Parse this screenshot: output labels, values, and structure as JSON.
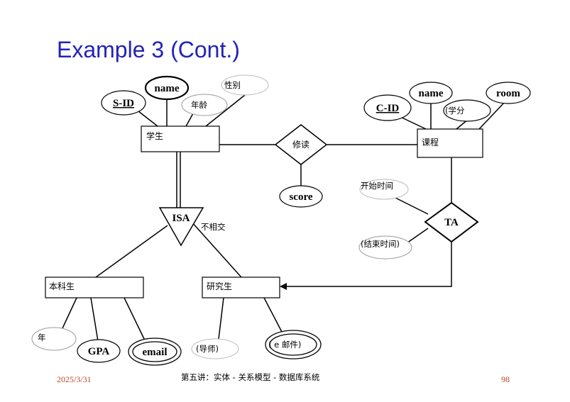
{
  "title": "Example 3 (Cont.)",
  "footer": {
    "date": "2025/3/31",
    "center": "第五讲：实体 - 关系模型 - 数据库系统",
    "page": "98"
  },
  "entities": {
    "student": "学生",
    "course": "课程",
    "undergrad": "本科生",
    "graduate": "研究生"
  },
  "relationships": {
    "takes": "修读",
    "ta": "TA",
    "isa": "ISA"
  },
  "attributes": {
    "s_id": "S-ID",
    "s_name": "name",
    "gender": "性别",
    "age": "年龄",
    "score": "score",
    "c_id": "C-ID",
    "c_name": "name",
    "credit": "(学分",
    "room": "room",
    "start_time": "开始时间",
    "end_time": "(结束时间)",
    "year": "年",
    "gpa": "GPA",
    "email": "email",
    "advisor": "(导师)",
    "e_mail": "( e 邮件)"
  },
  "annotations": {
    "disjoint": "不相交"
  }
}
